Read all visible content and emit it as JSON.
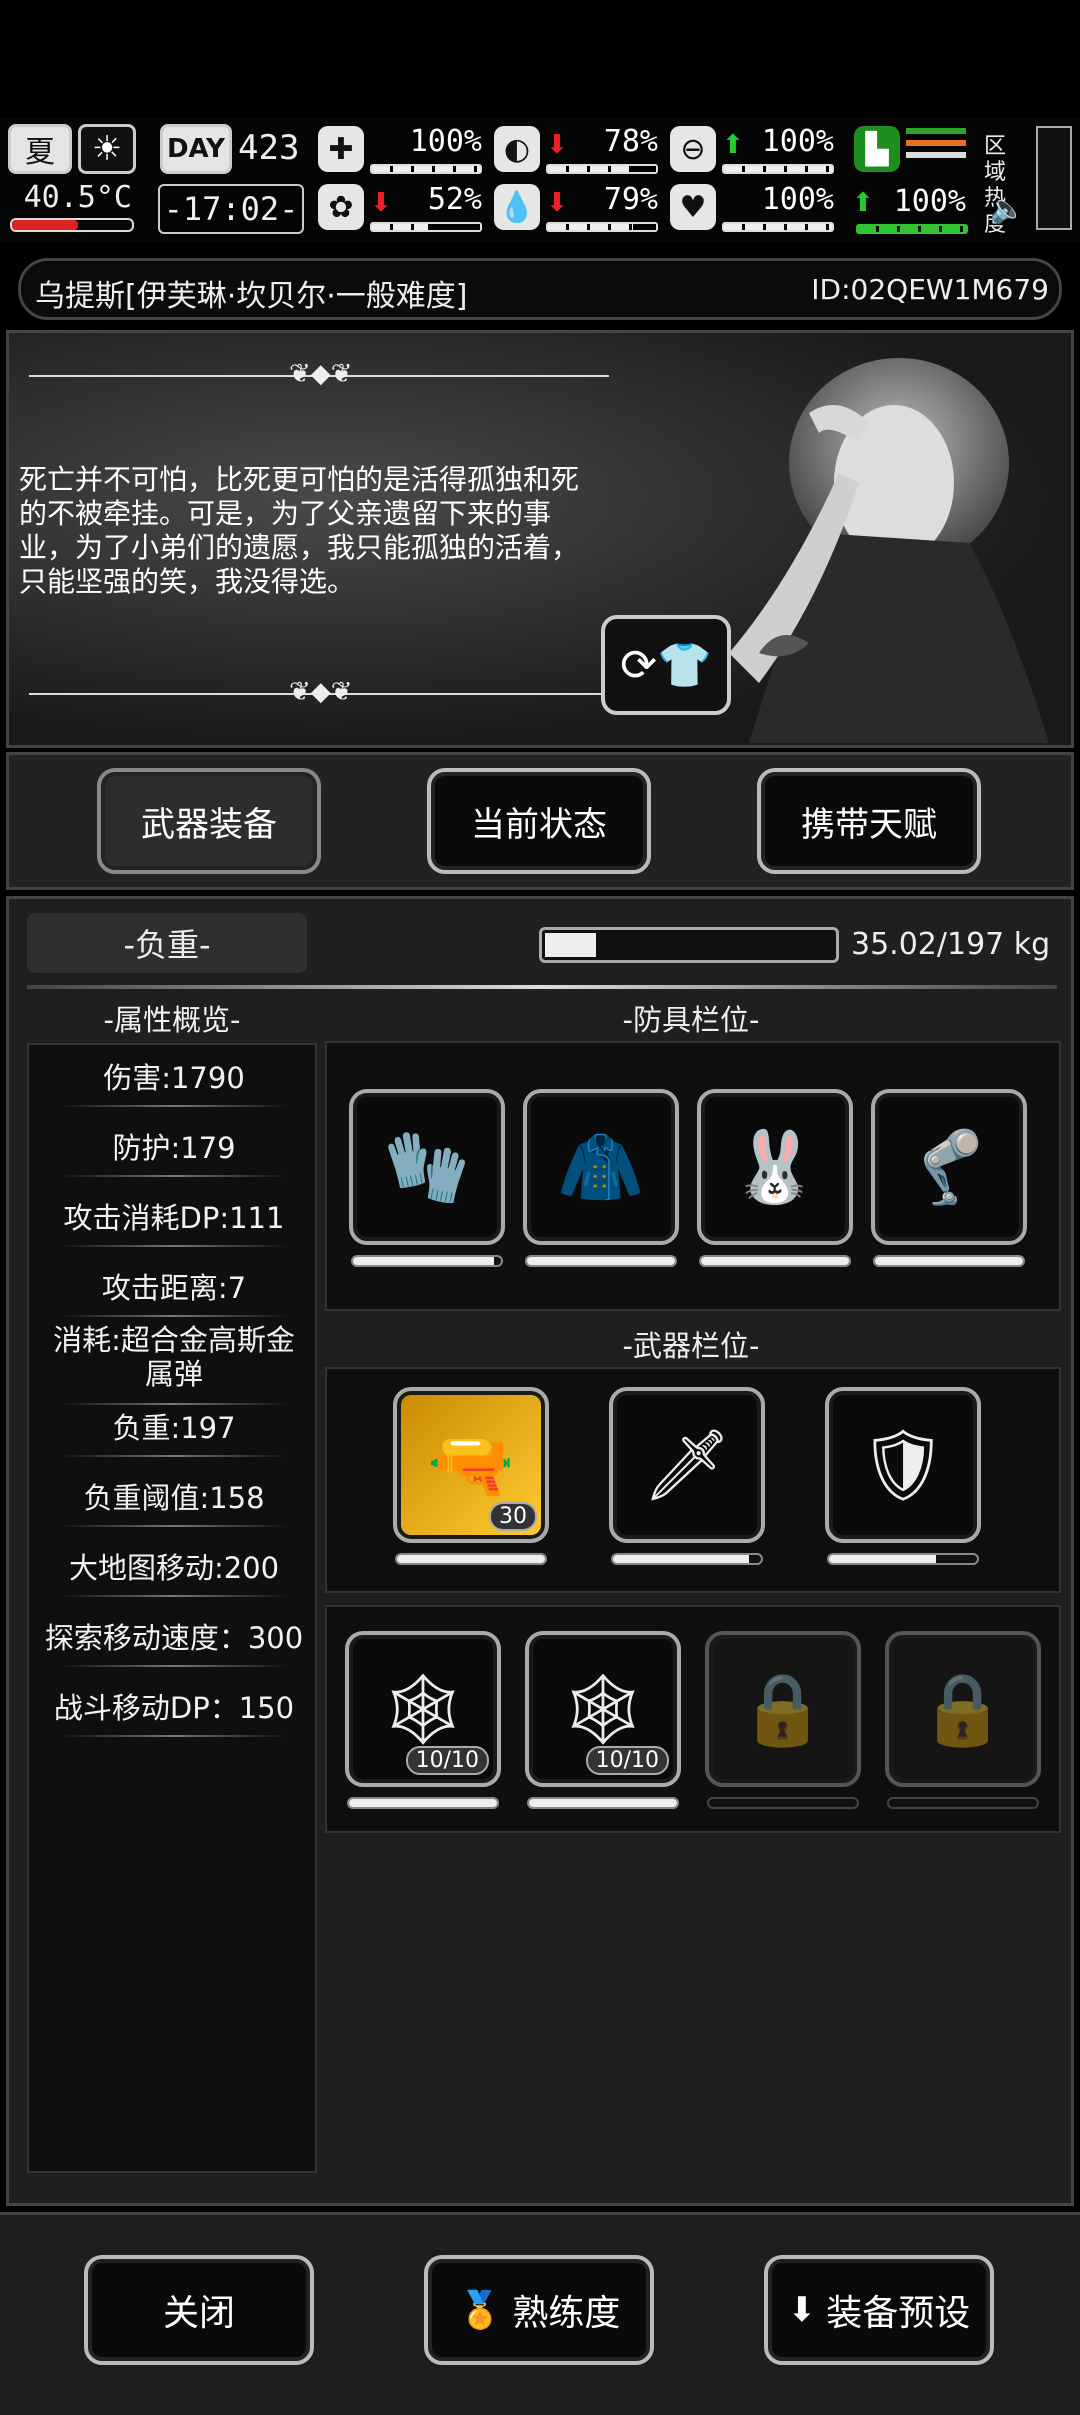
{
  "hud": {
    "season": "夏",
    "day_label": "DAY",
    "day": "423",
    "temperature": "40.5°C",
    "time": "-17:02-",
    "stats": [
      {
        "icon": "medkit-icon",
        "value": "100%",
        "trend": "none",
        "level": 1.0
      },
      {
        "icon": "stomach-icon",
        "value": "78%",
        "trend": "down",
        "level": 0.78
      },
      {
        "icon": "pill-icon",
        "value": "100%",
        "trend": "up",
        "level": 1.0
      },
      {
        "icon": "brain-icon",
        "value": "52%",
        "trend": "down",
        "level": 0.52
      },
      {
        "icon": "water-drop-icon",
        "value": "79%",
        "trend": "down",
        "level": 0.79
      },
      {
        "icon": "heart-icon",
        "value": "100%",
        "trend": "none",
        "level": 1.0
      }
    ],
    "stamina": {
      "icon": "boot-icon",
      "value": "100%",
      "trend": "up",
      "level": 1.0
    },
    "zone_heat_label": "区域\n热度",
    "zone_heat": [
      "区域",
      "热度"
    ]
  },
  "character": {
    "title": "乌提斯[伊芙琳·坎贝尔·一般难度]",
    "id": "ID:02QEW1M679",
    "quote": "死亡并不可怕，比死更可怕的是活得孤独和死的不被牵挂。可是，为了父亲遗留下来的事业，为了小弟们的遗愿，我只能孤独的活着，只能坚强的笑，我没得选。"
  },
  "tabs": [
    "武器装备",
    "当前状态",
    "携带天赋"
  ],
  "load": {
    "label": "-负重-",
    "value": "35.02/197 kg",
    "fraction": 0.178
  },
  "attributes": {
    "header": "-属性概览-",
    "items": [
      "伤害:1790",
      "防护:179",
      "攻击消耗DP:111",
      "攻击距离:7",
      "消耗:超合金高斯金属弹",
      "负重:197",
      "负重阈值:158",
      "大地图移动:200",
      "探索移动速度：300",
      "战斗移动DP：150"
    ]
  },
  "armor": {
    "header": "-防具栏位-",
    "slots": [
      {
        "icon": "gauntlets-icon",
        "durability": 0.95
      },
      {
        "icon": "bunny-hoodie-icon",
        "durability": 1.0
      },
      {
        "icon": "bunny-mask-icon",
        "durability": 1.0
      },
      {
        "icon": "exo-legs-icon",
        "durability": 1.0
      }
    ]
  },
  "weapons": {
    "header": "-武器栏位-",
    "slots": [
      {
        "icon": "gauss-rifle-icon",
        "badge": "30",
        "durability": 1.0
      },
      {
        "icon": "spear-icon",
        "durability": 0.92
      },
      {
        "icon": "armor-pack-icon",
        "durability": 0.72
      }
    ]
  },
  "consumables": {
    "slots": [
      {
        "icon": "net-icon",
        "badge": "10/10",
        "locked": false,
        "durability": 1.0
      },
      {
        "icon": "net-icon",
        "badge": "10/10",
        "locked": false,
        "durability": 1.0
      },
      {
        "icon": "lock-icon",
        "locked": true,
        "durability": 0
      },
      {
        "icon": "lock-icon",
        "locked": true,
        "durability": 0
      }
    ]
  },
  "bottom": {
    "close": "关闭",
    "proficiency": "熟练度",
    "preset": "装备预设"
  }
}
